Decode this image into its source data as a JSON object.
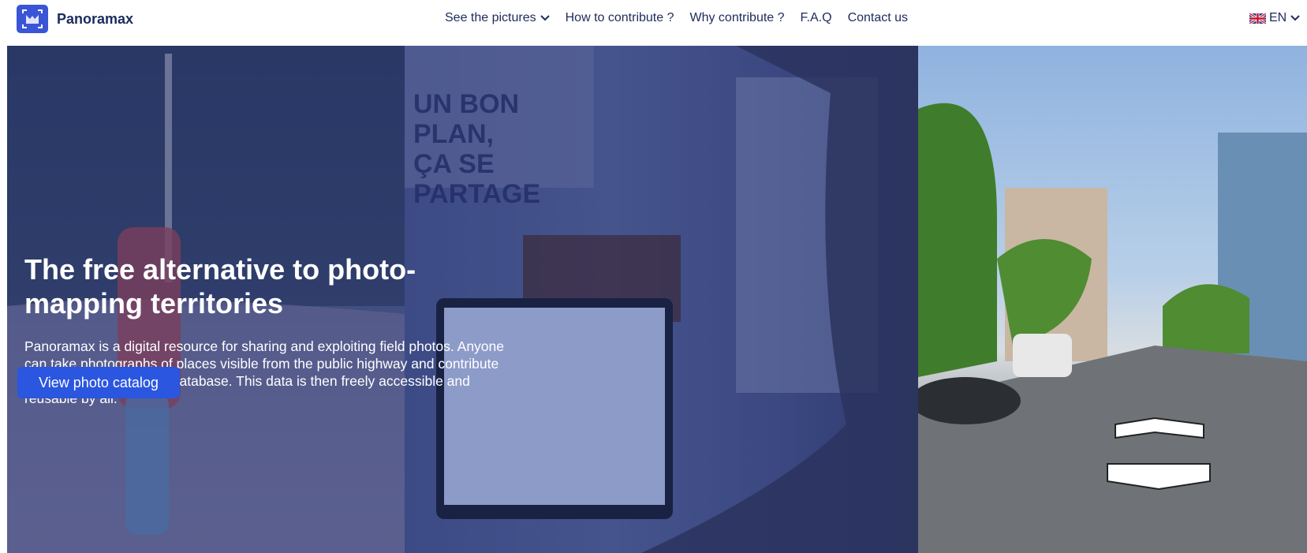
{
  "brand": {
    "name": "Panoramax"
  },
  "nav": {
    "items": [
      {
        "label": "See the pictures",
        "dropdown": true
      },
      {
        "label": "How to contribute ?"
      },
      {
        "label": "Why contribute ?"
      },
      {
        "label": "F.A.Q"
      },
      {
        "label": "Contact us"
      }
    ]
  },
  "language": {
    "label": "EN",
    "flag": "uk-flag-icon"
  },
  "hero": {
    "title": "The free alternative to photo-mapping territories",
    "description": "Panoramax is a digital resource for sharing and exploiting field photos. Anyone can take photographs of places visible from the public highway and contribute them to the Panoramax database. This data is then freely accessible and reusable by all.",
    "cta_label": "View photo catalog",
    "poster_text": [
      "UN BON",
      "PLAN,",
      "ÇA SE",
      "PARTAGE"
    ]
  },
  "colors": {
    "brand": "#3a55d6",
    "cta": "#2a56e0",
    "text_dark": "#1d2b5a"
  }
}
